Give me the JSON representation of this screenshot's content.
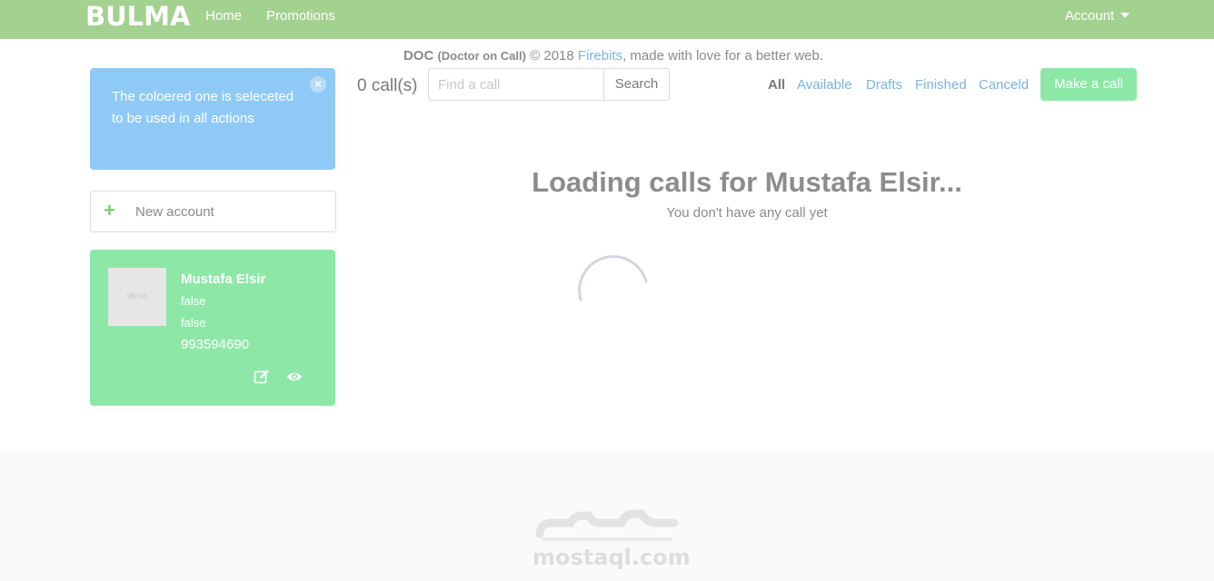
{
  "navbar": {
    "brand": "BULMA",
    "links": [
      "Home",
      "Promotions"
    ],
    "account_label": "Account"
  },
  "notification": {
    "text": "The coloered one is seleceted to be used in all actions",
    "close_symbol": "×"
  },
  "new_account": {
    "label": "New account",
    "icon": "plus-icon"
  },
  "account_card": {
    "name": "Mustafa Elsir",
    "line1": "false",
    "line2": "false",
    "phone": "993594690",
    "avatar_text": "96×96",
    "icons": [
      "edit-icon",
      "eye-icon"
    ],
    "color": "#8de8a8"
  },
  "calls": {
    "count_label": "0 call(s)",
    "search_placeholder": "Find a call",
    "search_button": "Search",
    "filters": [
      "All",
      "Available",
      "Drafts",
      "Finished",
      "Canceld"
    ],
    "active_filter": "All",
    "make_call_label": "Make a call",
    "loading_title": "Loading calls for Mustafa Elsir...",
    "empty_text": "You don't have any call yet"
  },
  "footer": {
    "brand": "DOC",
    "brand_full": "(Doctor on Call)",
    "copyright": "© 2018",
    "link": "Firebits",
    "tagline": ", made with love for a better web."
  },
  "watermark": {
    "text": "mostaql.com"
  },
  "colors": {
    "navbar": "#a3d18f",
    "info": "#8fcaf7",
    "success": "#8de8a8",
    "link": "#7bb3e0"
  }
}
